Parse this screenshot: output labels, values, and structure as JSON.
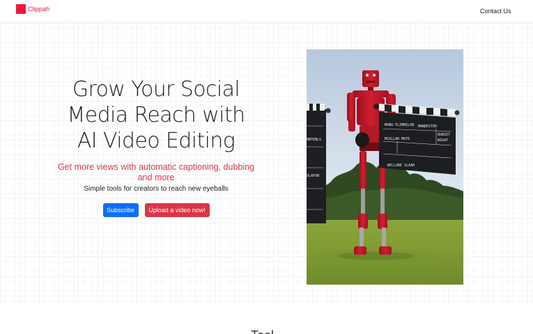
{
  "nav": {
    "brand": "Clippah",
    "brand_color": "#f0163c",
    "contact": "Contact Us"
  },
  "hero": {
    "title": "Grow Your Social Media Reach with AI Video Editing",
    "subtitle": "Get more views with automatic captioning, dubbing and more",
    "tagline": "Simple tools for creators to reach new eyeballs",
    "subscribe_label": "Subscribe",
    "upload_label": "Upload a video now!",
    "image": {
      "description_icon": "robot-with-clapperboard-image",
      "board_text_1": "MONO-TLIMNILON",
      "board_text_2": "MANDESTER",
      "board_text_3": "RUKOIT",
      "board_text_4": "NIGAT",
      "board_text_5": "MSILLAR MATE",
      "board_text_6": "WELLURE SLAAR",
      "left_board_text_1": "HNTENLS",
      "left_board_text_2": "SLAPVN"
    }
  },
  "section_partial_heading": "Tool"
}
